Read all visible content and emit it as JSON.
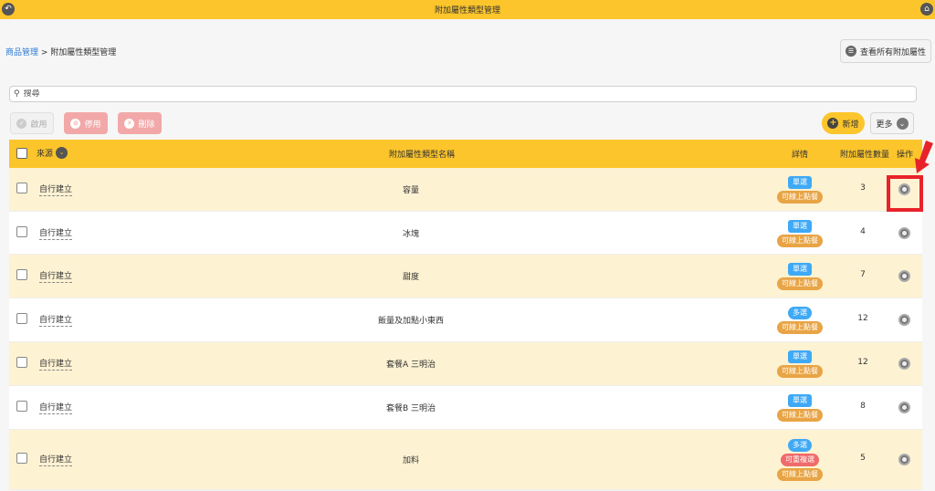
{
  "window": {
    "title": "附加屬性類型管理"
  },
  "breadcrumb": {
    "root": "商品管理",
    "separator": " > ",
    "current": "附加屬性類型管理"
  },
  "header": {
    "view_all_label": "查看所有附加屬性"
  },
  "search": {
    "placeholder": "搜尋"
  },
  "toolbar": {
    "enable_label": "啟用",
    "disable_label": "停用",
    "delete_label": "刪除",
    "add_label": "新增",
    "more_label": "更多"
  },
  "table": {
    "columns": {
      "source": "來源",
      "name": "附加屬性類型名稱",
      "detail": "詳情",
      "count": "附加屬性數量",
      "operation": "操作"
    },
    "rows": [
      {
        "source": "自行建立",
        "name": "容量",
        "tags": [
          "單選",
          "可線上點餐"
        ],
        "count": "3"
      },
      {
        "source": "自行建立",
        "name": "冰塊",
        "tags": [
          "單選",
          "可線上點餐"
        ],
        "count": "4"
      },
      {
        "source": "自行建立",
        "name": "甜度",
        "tags": [
          "單選",
          "可線上點餐"
        ],
        "count": "7"
      },
      {
        "source": "自行建立",
        "name": "飯量及加點小東西",
        "tags": [
          "多選",
          "可線上點餐"
        ],
        "count": "12"
      },
      {
        "source": "自行建立",
        "name": "套餐A 三明治",
        "tags": [
          "單選",
          "可線上點餐"
        ],
        "count": "12"
      },
      {
        "source": "自行建立",
        "name": "套餐B 三明治",
        "tags": [
          "單選",
          "可線上點餐"
        ],
        "count": "8"
      },
      {
        "source": "自行建立",
        "name": "加料",
        "tags": [
          "多選",
          "可重複選",
          "可線上點餐"
        ],
        "count": "5"
      }
    ]
  },
  "colors": {
    "accent": "#fcc52b",
    "link": "#2b7bd6",
    "tag_blue": "#3fa9f5",
    "tag_orange": "#e8a445",
    "tag_red": "#ef6b6b",
    "danger_soft": "#f2a8a8",
    "annotation": "#e8222a"
  }
}
